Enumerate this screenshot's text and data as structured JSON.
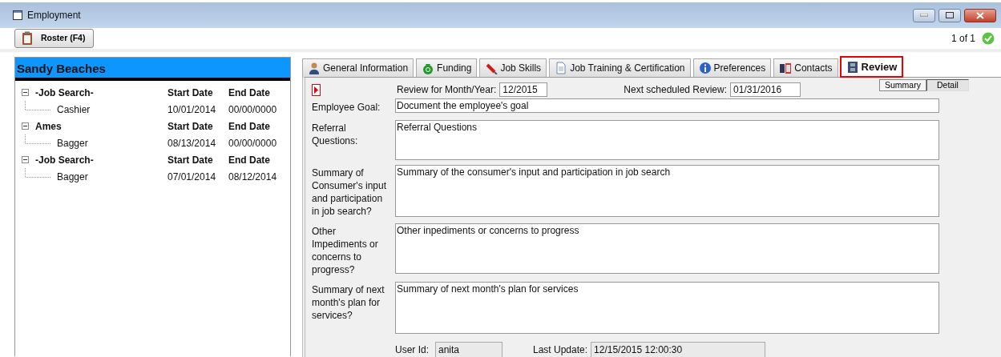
{
  "window": {
    "title": "Employment"
  },
  "toolbar": {
    "roster_button": "Roster (F4)",
    "record_count": "1 of 1"
  },
  "person": {
    "name": "Sandy Beaches"
  },
  "history": [
    {
      "employer": "-Job Search-",
      "start_header": "Start Date",
      "end_header": "End Date",
      "expanded": true,
      "children": [
        {
          "title": "Cashier",
          "start": "10/01/2014",
          "end": "00/00/0000"
        }
      ]
    },
    {
      "employer": "Ames",
      "start_header": "Start Date",
      "end_header": "End Date",
      "expanded": true,
      "children": [
        {
          "title": "Bagger",
          "start": "08/13/2014",
          "end": "00/00/0000"
        }
      ]
    },
    {
      "employer": "-Job Search-",
      "start_header": "Start Date",
      "end_header": "End Date",
      "expanded": true,
      "children": [
        {
          "title": "Bagger",
          "start": "07/01/2014",
          "end": "08/12/2014"
        }
      ]
    }
  ],
  "tabs": [
    {
      "label": "General Information",
      "selected": false
    },
    {
      "label": "Funding",
      "selected": false
    },
    {
      "label": "Job Skills",
      "selected": false
    },
    {
      "label": "Job Training & Certification",
      "selected": false
    },
    {
      "label": "Preferences",
      "selected": false
    },
    {
      "label": "Contacts",
      "selected": false
    },
    {
      "label": "Review",
      "selected": true
    }
  ],
  "review": {
    "month_label": "Review for Month/Year:",
    "month_value": "12/2015",
    "next_label": "Next scheduled Review:",
    "next_value": "01/31/2016",
    "views": [
      {
        "label": "Summary",
        "selected": false
      },
      {
        "label": "Detail",
        "selected": true
      }
    ],
    "fields": [
      {
        "kind": "line",
        "label": "Employee Goal:",
        "value": "Document the employee's goal"
      },
      {
        "kind": "area",
        "label": "Referral Questions:",
        "value": "Referral Questions"
      },
      {
        "kind": "area",
        "label": "Summary of Consumer's input and participation in job search?",
        "value": "Summary of the consumer's input and participation in job search"
      },
      {
        "kind": "area",
        "label": "Other Impediments or concerns to progress?",
        "value": "Other inpediments or concerns to progress"
      },
      {
        "kind": "area",
        "label": "Summary of next month's plan for services?",
        "value": "Summary of next month's plan for services"
      }
    ],
    "user_label": "User Id:",
    "user_value": "anita",
    "update_label": "Last Update:",
    "update_value": "12/15/2015 12:00:30"
  }
}
